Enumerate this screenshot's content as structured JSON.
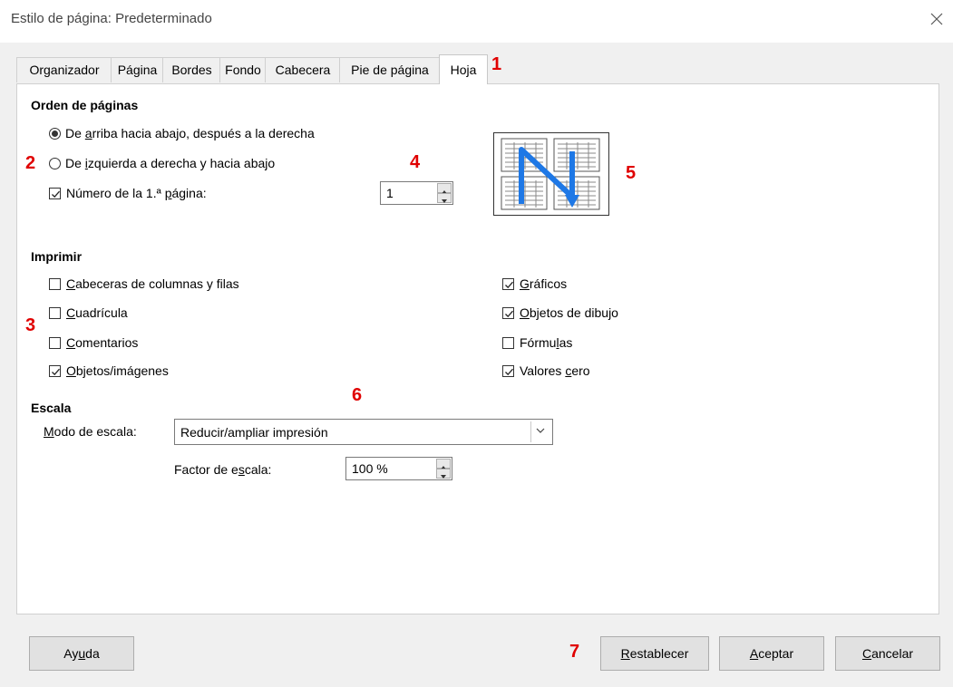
{
  "window": {
    "title": "Estilo de página: Predeterminado"
  },
  "tabs": [
    {
      "label": "Organizador"
    },
    {
      "label": "Página"
    },
    {
      "label": "Bordes"
    },
    {
      "label": "Fondo"
    },
    {
      "label": "Cabecera"
    },
    {
      "label": "Pie de página"
    },
    {
      "label": "Hoja",
      "active": true
    }
  ],
  "page_order": {
    "heading": "Orden de páginas",
    "option1": {
      "pre": "De ",
      "key": "a",
      "post": "rriba hacia abajo, después a la derecha",
      "selected": true
    },
    "option2": {
      "pre": "De ",
      "key": "i",
      "post": "zquierda a derecha y hacia abajo",
      "selected": false
    },
    "first_page": {
      "pre": "Número de la 1.ª ",
      "key": "p",
      "post": "ágina:",
      "checked": true,
      "value": "1"
    }
  },
  "print": {
    "heading": "Imprimir",
    "left": [
      {
        "key": "C",
        "post": "abeceras de columnas y filas",
        "checked": false
      },
      {
        "key": "C",
        "post": "uadrícula",
        "checked": false
      },
      {
        "key": "C",
        "post": "omentarios",
        "checked": false
      },
      {
        "key": "O",
        "post": "bjetos/imágenes",
        "checked": true
      }
    ],
    "right": [
      {
        "pre": "",
        "key": "G",
        "post": "ráficos",
        "checked": true
      },
      {
        "pre": "",
        "key": "O",
        "post": "bjetos de dibujo",
        "checked": true
      },
      {
        "pre": "Fórmu",
        "key": "l",
        "post": "as",
        "checked": false
      },
      {
        "pre": "Valores ",
        "key": "c",
        "post": "ero",
        "checked": true
      }
    ]
  },
  "scale": {
    "heading": "Escala",
    "mode_label": {
      "key": "M",
      "post": "odo de escala:"
    },
    "mode_value": "Reducir/ampliar impresión",
    "factor_label": {
      "pre": "Factor de e",
      "key": "s",
      "post": "cala:"
    },
    "factor_value": "100 %"
  },
  "buttons": {
    "help": {
      "pre": "Ay",
      "key": "u",
      "post": "da"
    },
    "reset": {
      "key": "R",
      "post": "establecer"
    },
    "ok": {
      "key": "A",
      "post": "ceptar"
    },
    "cancel": {
      "key": "C",
      "post": "ancelar"
    }
  },
  "callouts": [
    "1",
    "2",
    "3",
    "4",
    "5",
    "6",
    "7"
  ],
  "colors": {
    "callout": "#e00000",
    "preview_arrow": "#1e78e6"
  }
}
